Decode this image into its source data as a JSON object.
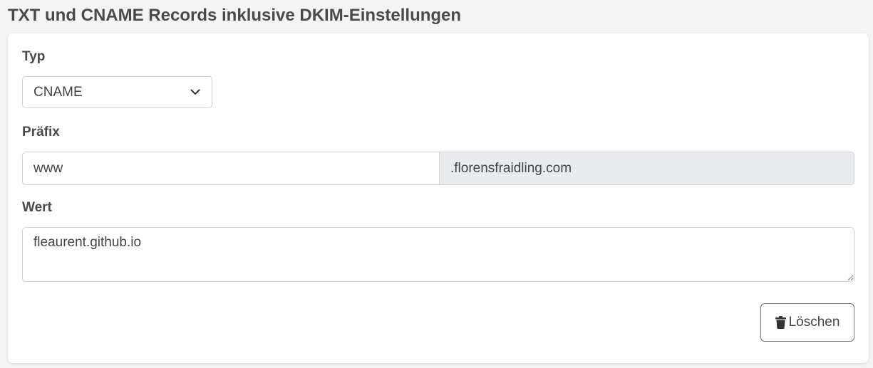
{
  "page": {
    "title": "TXT und CNAME Records inklusive DKIM-Einstellungen"
  },
  "form": {
    "type_label": "Typ",
    "type_value": "CNAME",
    "prefix_label": "Präfix",
    "prefix_value": "www",
    "domain_suffix": ".florensfraidling.com",
    "value_label": "Wert",
    "value_text": "fleaurent.github.io",
    "delete_label": "Löschen"
  },
  "icons": {
    "select_chevron": "chevron-down-icon",
    "delete": "trash-icon"
  }
}
